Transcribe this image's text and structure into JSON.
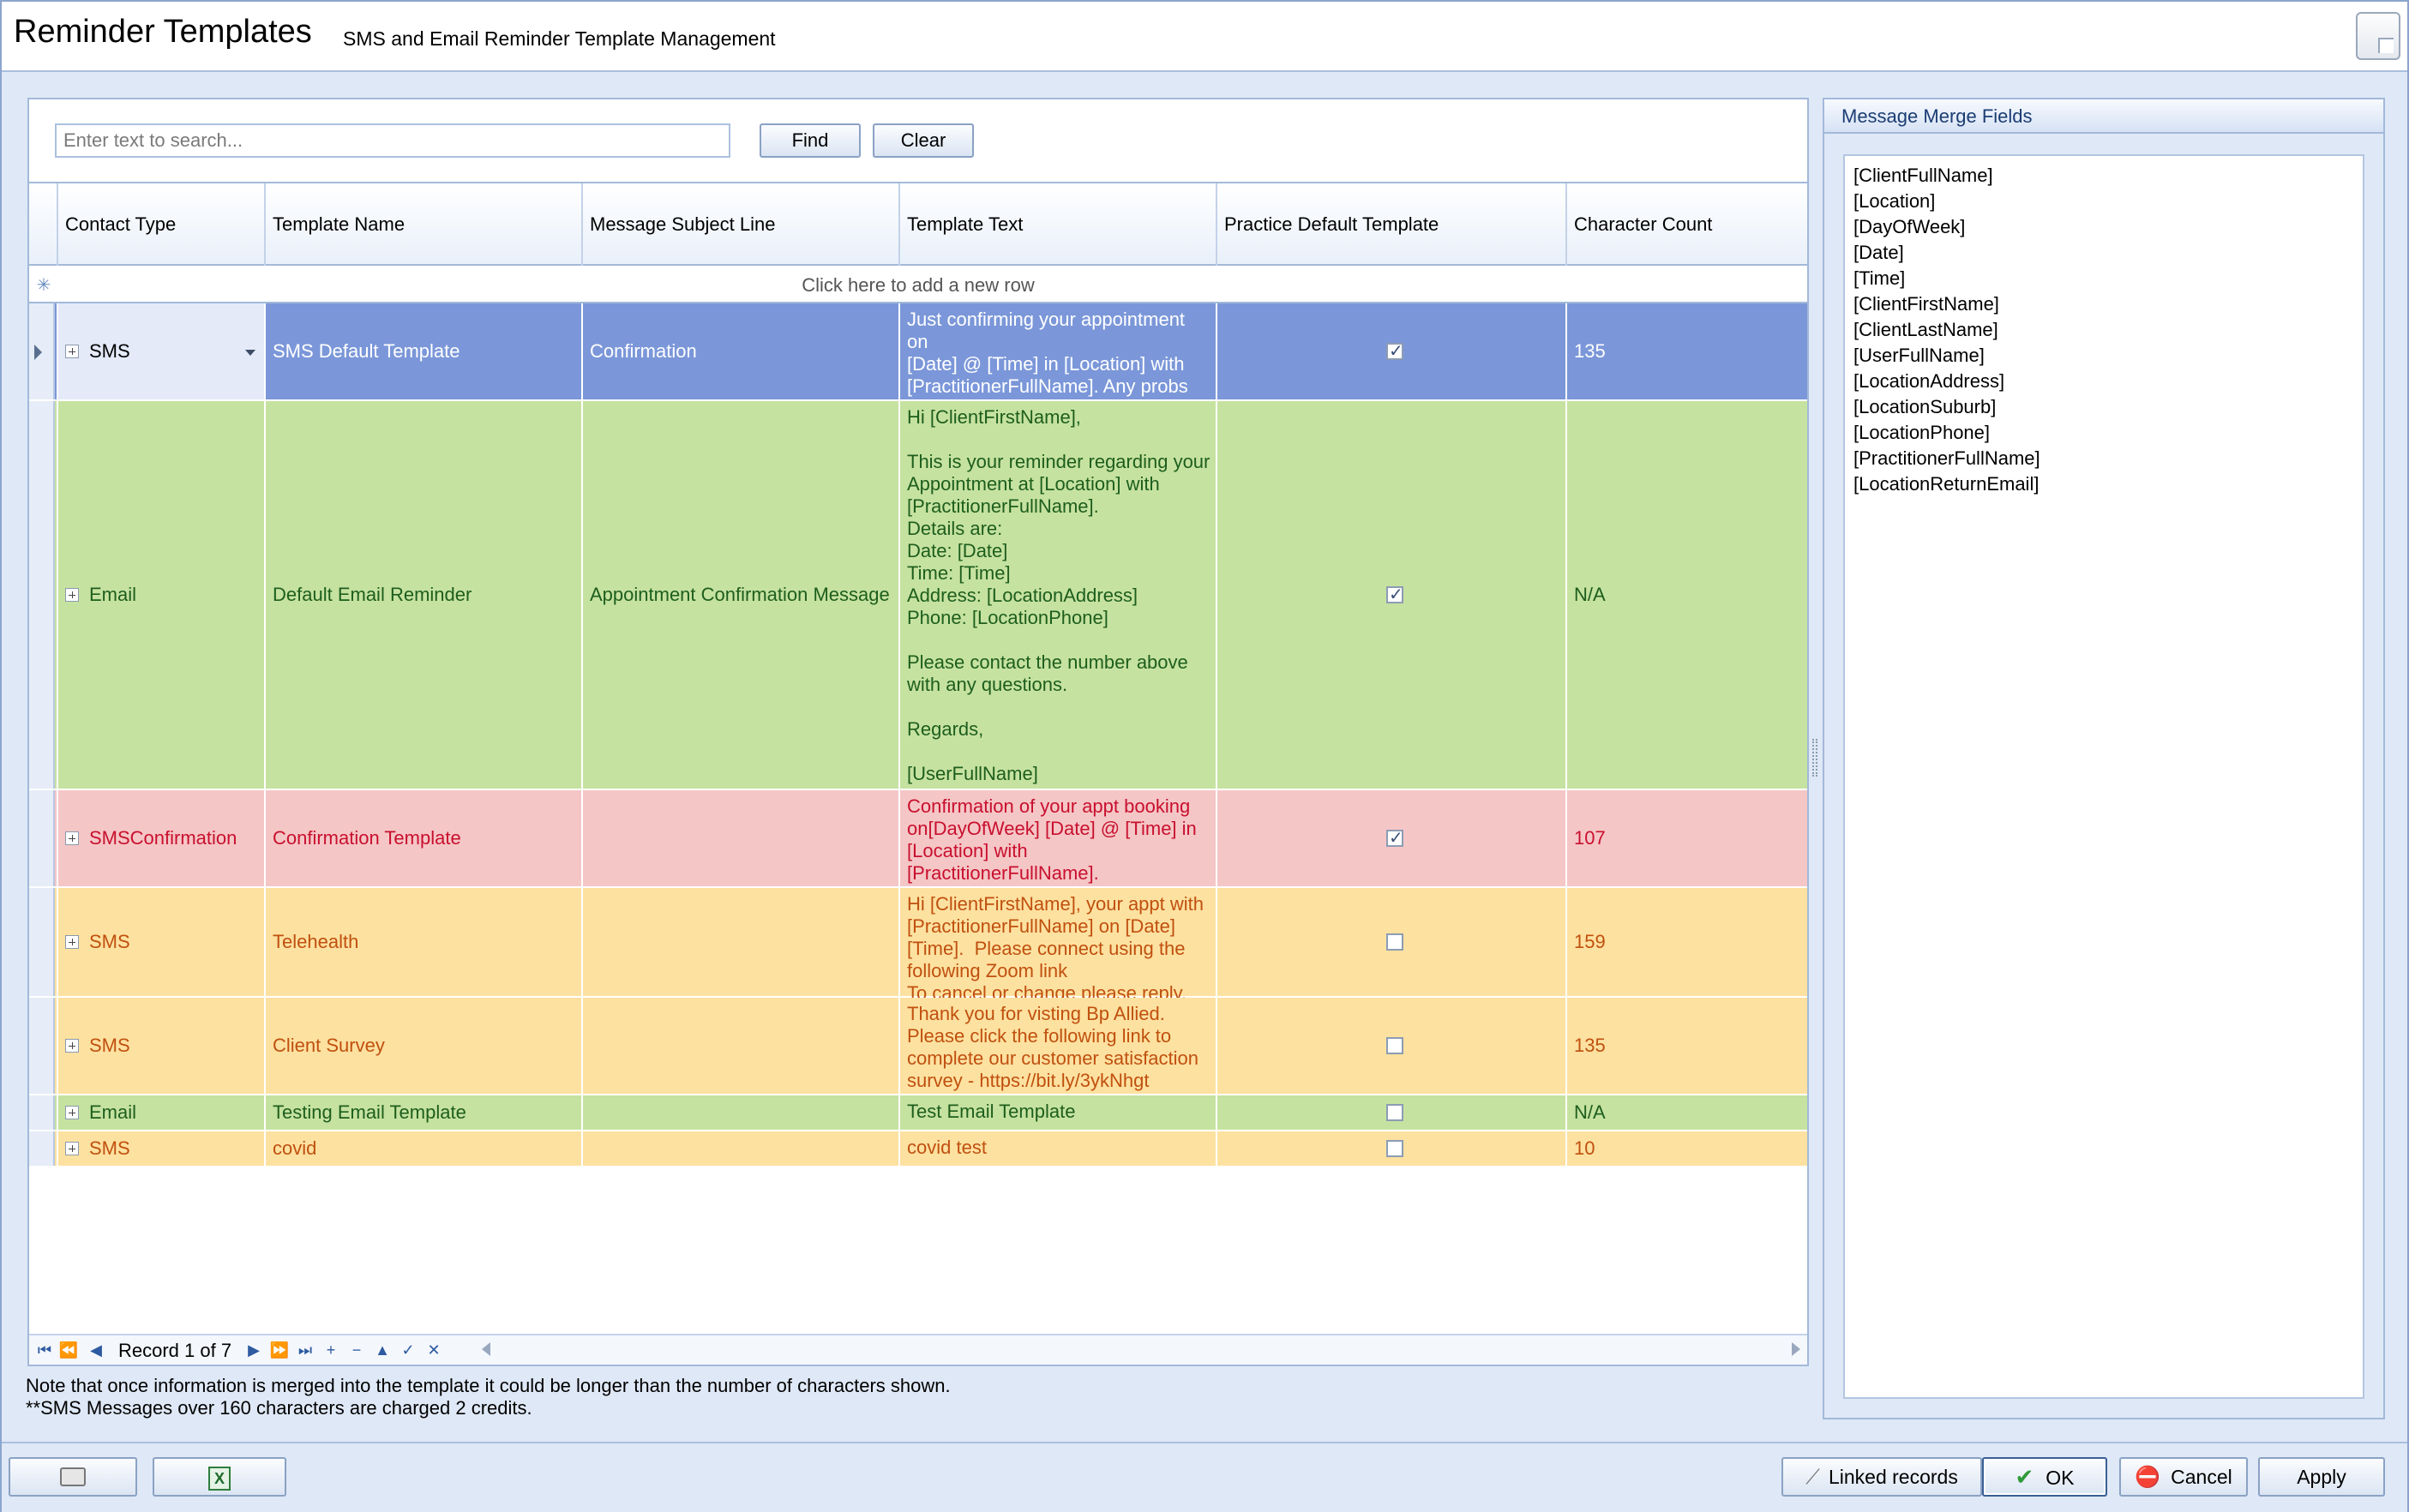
{
  "window": {
    "title": "Reminder Templates",
    "subtitle": "SMS and Email Reminder Template Management"
  },
  "search": {
    "placeholder": "Enter text to search...",
    "find_label": "Find",
    "clear_label": "Clear"
  },
  "grid": {
    "columns": [
      "Contact Type",
      "Template Name",
      "Message Subject Line",
      "Template Text",
      "Practice Default Template",
      "Character Count"
    ],
    "new_row_text": "Click here to add a new row",
    "rows": [
      {
        "contact_type": "SMS",
        "template_name": "SMS Default Template",
        "subject": "Confirmation",
        "text": "Just confirming your appointment on\n[Date] @ [Time] in [Location] with\n[PractitionerFullName]. Any probs\nplease call on [LocationPhone]",
        "default": true,
        "count": "135",
        "bg": "#7b97d9",
        "fg": "#ffffff"
      },
      {
        "contact_type": "Email",
        "template_name": "Default Email Reminder",
        "subject": "Appointment Confirmation Message",
        "text": "Hi [ClientFirstName],\n\nThis is your reminder regarding your\nAppointment at [Location] with\n[PractitionerFullName].\nDetails are:\nDate: [Date]\nTime: [Time]\nAddress: [LocationAddress]\nPhone: [LocationPhone]\n\nPlease contact the number above\nwith any questions.\n\nRegards,\n\n[UserFullName]",
        "default": true,
        "count": "N/A",
        "bg": "#c6e2a0",
        "fg": "#1d5e1d"
      },
      {
        "contact_type": "SMSConfirmation",
        "template_name": "Confirmation Template",
        "subject": "",
        "text": "Confirmation of your appt booking\non[DayOfWeek] [Date] @ [Time] in\n[Location] with\n[PractitionerFullName].",
        "default": true,
        "count": "107",
        "bg": "#f5c6c6",
        "fg": "#c8102e"
      },
      {
        "contact_type": "SMS",
        "template_name": "Telehealth",
        "subject": "",
        "text": "Hi [ClientFirstName], your appt with\n[PractitionerFullName] on [Date]\n[Time].  Please connect using the\nfollowing Zoom link\nTo cancel or change please reply.",
        "default": false,
        "count": "159",
        "bg": "#fde1a0",
        "fg": "#c0500f"
      },
      {
        "contact_type": "SMS",
        "template_name": "Client Survey",
        "subject": "",
        "text": "Thank you for visting Bp Allied.\nPlease click the following link to\ncomplete our customer satisfaction\nsurvey - https://bit.ly/3ykNhgt",
        "default": false,
        "count": "135",
        "bg": "#fde1a0",
        "fg": "#c0500f"
      },
      {
        "contact_type": "Email",
        "template_name": "Testing Email Template",
        "subject": "",
        "text": "Test Email Template",
        "default": false,
        "count": "N/A",
        "bg": "#c6e2a0",
        "fg": "#1d5e1d"
      },
      {
        "contact_type": "SMS",
        "template_name": "covid",
        "subject": "",
        "text": "covid test",
        "default": false,
        "count": "10",
        "bg": "#fde1a0",
        "fg": "#c0500f"
      }
    ]
  },
  "navigator": {
    "record_text": "Record 1 of 7",
    "icons": [
      "first-icon",
      "prev-page-icon",
      "prev-icon",
      "next-icon",
      "next-page-icon",
      "last-icon",
      "append-icon",
      "delete-icon",
      "edit-icon",
      "post-icon",
      "cancel-edit-icon"
    ]
  },
  "notes": {
    "line1": "Note that once information is merged into the template it could be longer than the number of characters shown.",
    "line2": "**SMS Messages over 160 characters are charged 2 credits."
  },
  "merge_fields": {
    "title": "Message Merge Fields",
    "items": [
      "[ClientFullName]",
      "[Location]",
      "[DayOfWeek]",
      "[Date]",
      "[Time]",
      "[ClientFirstName]",
      "[ClientLastName]",
      "[UserFullName]",
      "[LocationAddress]",
      "[LocationSuburb]",
      "[LocationPhone]",
      "[PractitionerFullName]",
      "[LocationReturnEmail]"
    ]
  },
  "buttons": {
    "linked_records": "Linked records",
    "ok": "OK",
    "cancel": "Cancel",
    "apply": "Apply"
  }
}
